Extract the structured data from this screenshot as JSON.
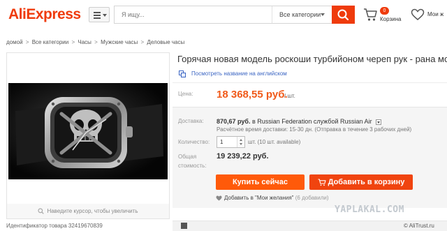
{
  "header": {
    "logo": "AliExpress",
    "search_placeholder": "Я ищу...",
    "category_select": "Все категории",
    "cart_count": "0",
    "cart_label": "Корзина",
    "wishlist_label": "Мои ж",
    "accent": "#ef3b0c"
  },
  "breadcrumb": [
    "домой",
    "Все категории",
    "Часы",
    "Мужские часы",
    "Деловые часы"
  ],
  "breadcrumb_sep": ">",
  "gallery": {
    "zoom_hint": "Наведите курсор, чтобы увеличить",
    "item_id": "Идентификатор товара 32419670839"
  },
  "product": {
    "title": "Горячая новая модель роскоши турбийоном череп рук - рана мода часы",
    "translate_link": "Посмотреть название на английском",
    "price_label": "Цена:",
    "price": "18 368,55 руб.",
    "price_unit": "/ шт.",
    "price_color": "#f05a1a"
  },
  "purchase": {
    "shipping_label": "Доставка:",
    "shipping_price": "870,67 руб.",
    "shipping_to": "в Russian Federation службой Russian Air",
    "shipping_note": "Расчётное время доставки: 15-30 дн. (Отправка в течение 3 рабочих дней)",
    "quantity_label": "Количество:",
    "quantity_value": "1",
    "quantity_avail": "шт. (10 шт. available)",
    "total_label_1": "Общая",
    "total_label_2": "стоимость:",
    "total_value": "19 239,22 руб.",
    "buy_now": "Купить сейчас",
    "add_to_cart": "Добавить в корзину",
    "wishlist_add": "Добавить в \"Мои желания\"",
    "wishlist_count": "(6 добавили)"
  },
  "watermark": "YAPLAKAL.COM",
  "credit": "© AliTrust.ru"
}
